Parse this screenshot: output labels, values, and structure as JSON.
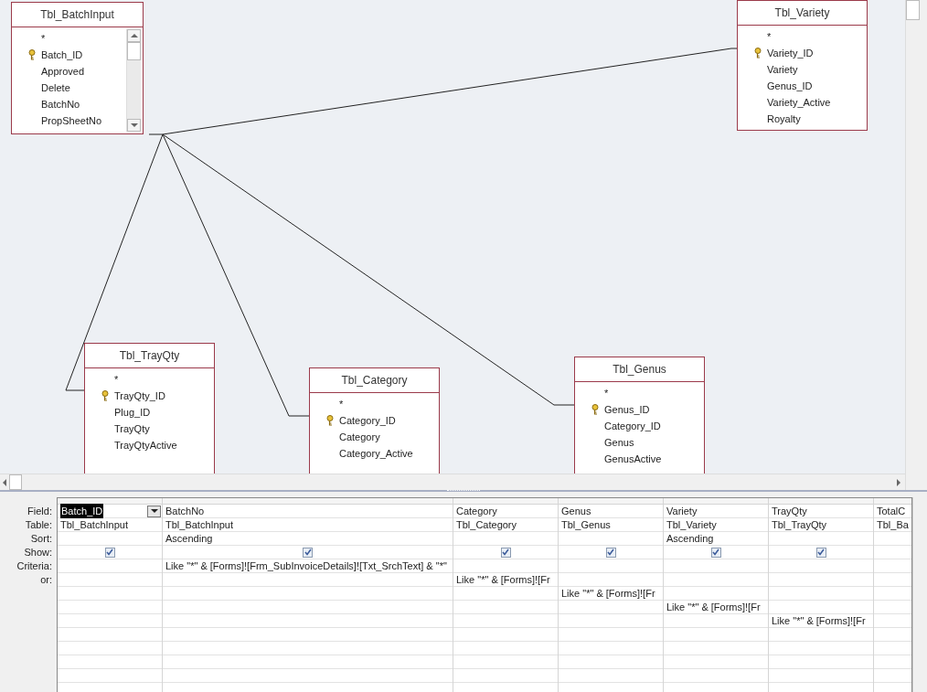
{
  "diagram": {
    "tables": [
      {
        "name": "Tbl_BatchInput",
        "scrollable": true,
        "fields": [
          {
            "name": "*",
            "key": false
          },
          {
            "name": "Batch_ID",
            "key": true
          },
          {
            "name": "Approved",
            "key": false
          },
          {
            "name": "Delete",
            "key": false
          },
          {
            "name": "BatchNo",
            "key": false
          },
          {
            "name": "PropSheetNo",
            "key": false
          }
        ]
      },
      {
        "name": "Tbl_Variety",
        "scrollable": false,
        "fields": [
          {
            "name": "*",
            "key": false
          },
          {
            "name": "Variety_ID",
            "key": true
          },
          {
            "name": "Variety",
            "key": false
          },
          {
            "name": "Genus_ID",
            "key": false
          },
          {
            "name": "Variety_Active",
            "key": false
          },
          {
            "name": "Royalty",
            "key": false
          }
        ]
      },
      {
        "name": "Tbl_TrayQty",
        "scrollable": false,
        "fields": [
          {
            "name": "*",
            "key": false
          },
          {
            "name": "TrayQty_ID",
            "key": true
          },
          {
            "name": "Plug_ID",
            "key": false
          },
          {
            "name": "TrayQty",
            "key": false
          },
          {
            "name": "TrayQtyActive",
            "key": false
          }
        ]
      },
      {
        "name": "Tbl_Category",
        "scrollable": false,
        "fields": [
          {
            "name": "*",
            "key": false
          },
          {
            "name": "Category_ID",
            "key": true
          },
          {
            "name": "Category",
            "key": false
          },
          {
            "name": "Category_Active",
            "key": false
          }
        ]
      },
      {
        "name": "Tbl_Genus",
        "scrollable": false,
        "fields": [
          {
            "name": "*",
            "key": false
          },
          {
            "name": "Genus_ID",
            "key": true
          },
          {
            "name": "Category_ID",
            "key": false
          },
          {
            "name": "Genus",
            "key": false
          },
          {
            "name": "GenusActive",
            "key": false
          }
        ]
      }
    ]
  },
  "grid": {
    "row_labels": [
      "Field:",
      "Table:",
      "Sort:",
      "Show:",
      "Criteria:",
      "or:"
    ],
    "columns": [
      {
        "field": "Batch_ID",
        "table": "Tbl_BatchInput",
        "selected": true,
        "show": true
      },
      {
        "field": "BatchNo",
        "table": "Tbl_BatchInput",
        "sort": "Ascending",
        "selected": false,
        "show": true,
        "criteria": {
          "kind": "criteria",
          "text": "Like \"*\" & [Forms]![Frm_SubInvoiceDetails]![Txt_SrchText] & \"*\""
        }
      },
      {
        "field": "Category",
        "table": "Tbl_Category",
        "selected": false,
        "show": true,
        "criteria": {
          "kind": "or",
          "text": "Like \"*\" & [Forms]![Fr"
        }
      },
      {
        "field": "Genus",
        "table": "Tbl_Genus",
        "selected": false,
        "show": true,
        "criteria": {
          "kind": "or2",
          "text": "Like \"*\" & [Forms]![Fr"
        }
      },
      {
        "field": "Variety",
        "table": "Tbl_Variety",
        "sort": "Ascending",
        "selected": false,
        "show": true,
        "criteria": {
          "kind": "or3",
          "text": "Like \"*\" & [Forms]![Fr"
        }
      },
      {
        "field": "TrayQty",
        "table": "Tbl_TrayQty",
        "selected": false,
        "show": true,
        "criteria": {
          "kind": "or4",
          "text": "Like \"*\" & [Forms]![Fr"
        }
      },
      {
        "field": "TotalC",
        "table": "Tbl_Ba",
        "selected": false
      }
    ]
  }
}
